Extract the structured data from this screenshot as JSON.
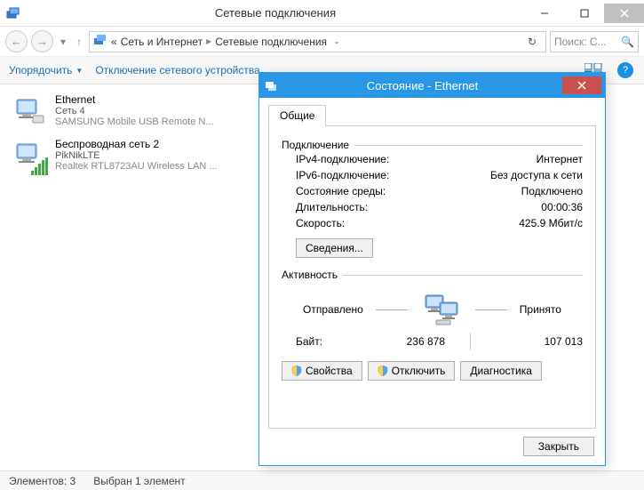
{
  "window": {
    "title": "Сетевые подключения"
  },
  "breadcrumb": {
    "prefix": "« ",
    "item1": "Сеть и Интернет",
    "item2": "Сетевые подключения"
  },
  "search": {
    "placeholder": "Поиск: С..."
  },
  "toolbar": {
    "organize": "Упорядочить",
    "disable": "Отключение сетевого устройства"
  },
  "connections": [
    {
      "name": "Ethernet",
      "network": "Сеть  4",
      "adapter": "SAMSUNG Mobile USB Remote N..."
    },
    {
      "name": "Беспроводная сеть 2",
      "network": "PikNikLTE",
      "adapter": "Realtek RTL8723AU Wireless LAN ..."
    }
  ],
  "statusbar": {
    "elements": "Элементов: 3",
    "selected": "Выбран 1 элемент"
  },
  "dialog": {
    "title": "Состояние - Ethernet",
    "tab_general": "Общие",
    "group_connection": "Подключение",
    "ipv4_label": "IPv4-подключение:",
    "ipv4_value": "Интернет",
    "ipv6_label": "IPv6-подключение:",
    "ipv6_value": "Без доступа к сети",
    "media_label": "Состояние среды:",
    "media_value": "Подключено",
    "duration_label": "Длительность:",
    "duration_value": "00:00:36",
    "speed_label": "Скорость:",
    "speed_value": "425.9 Мбит/с",
    "details_btn": "Сведения...",
    "group_activity": "Активность",
    "sent_label": "Отправлено",
    "received_label": "Принято",
    "bytes_label": "Байт:",
    "bytes_sent": "236 878",
    "bytes_received": "107 013",
    "properties_btn": "Свойства",
    "disable_btn": "Отключить",
    "diagnose_btn": "Диагностика",
    "close_btn": "Закрыть"
  }
}
